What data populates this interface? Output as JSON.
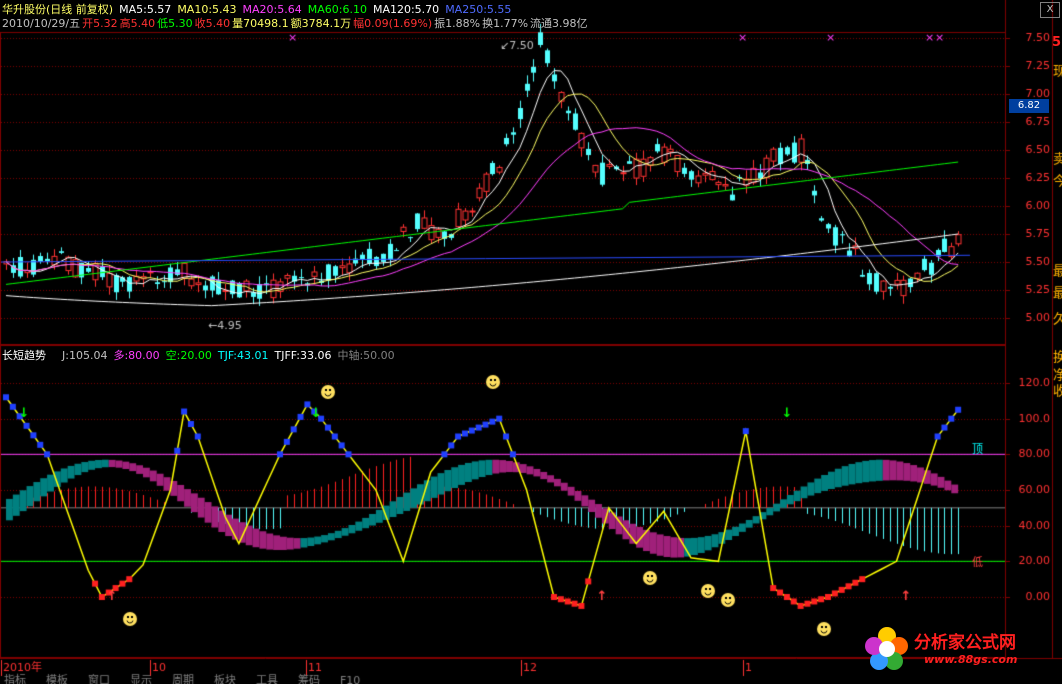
{
  "header": {
    "stock_name": "华升股份(日线 前复权)",
    "ma5": "MA5:5.57",
    "ma10": "MA10:5.43",
    "ma20": "MA20:5.64",
    "ma60": "MA60:6.10",
    "ma120": "MA120:5.70",
    "ma250": "MA250:5.55",
    "date": "2010/10/29/五",
    "open": "开5.32",
    "high": "高5.40",
    "low": "低5.30",
    "close": "收5.40",
    "volume": "量70498.1",
    "amount": "额3784.1万",
    "change": "幅0.09(1.69%)",
    "amplitude": "振1.88%",
    "turnover": "换1.77%",
    "float": "流通3.98亿",
    "close_button": "X"
  },
  "indicator_header": {
    "name": "长短趋势",
    "j": "J:105.04",
    "duo": "多:80.00",
    "kong": "空:20.00",
    "tjf": "TJF:43.01",
    "tjff": "TJFF:33.06",
    "zhongzhou": "中轴:50.00"
  },
  "price_axis": {
    "ticks": [
      "7.50",
      "7.25",
      "7.00",
      "6.75",
      "6.50",
      "6.25",
      "6.00",
      "5.75",
      "5.50",
      "5.25",
      "5.00"
    ],
    "current_price": "6.82",
    "high_marker": "7.50",
    "low_marker": "4.95",
    "top_label": "5"
  },
  "indicator_axis": {
    "ticks": [
      "120.0",
      "100.0",
      "80.00",
      "60.00",
      "40.00",
      "20.00",
      "0.00"
    ],
    "label_top": "顶",
    "label_bottom": "低"
  },
  "right_panel_labels": [
    "现",
    "卖",
    "今",
    "最",
    "最",
    "久",
    "换",
    "净",
    "收"
  ],
  "date_axis": {
    "labels": [
      "2010年",
      "10",
      "11",
      "12",
      "1"
    ]
  },
  "bottom_tabs": [
    "指标",
    "模板",
    "窗口",
    "显示",
    "周期",
    "板块",
    "工具",
    "筹码",
    "F10"
  ],
  "logo": {
    "main": "分析家公式网",
    "url": "www.88gs.com"
  },
  "colors": {
    "up": "#ff3232",
    "down": "#54ffff",
    "ma5": "#ffffff",
    "ma10": "#ffff66",
    "ma20": "#ff40ff",
    "ma60": "#00ff00",
    "ma120": "#ffffff",
    "ma250": "#2a4bff",
    "grid": "#800000",
    "panel_border": "#800000"
  }
}
